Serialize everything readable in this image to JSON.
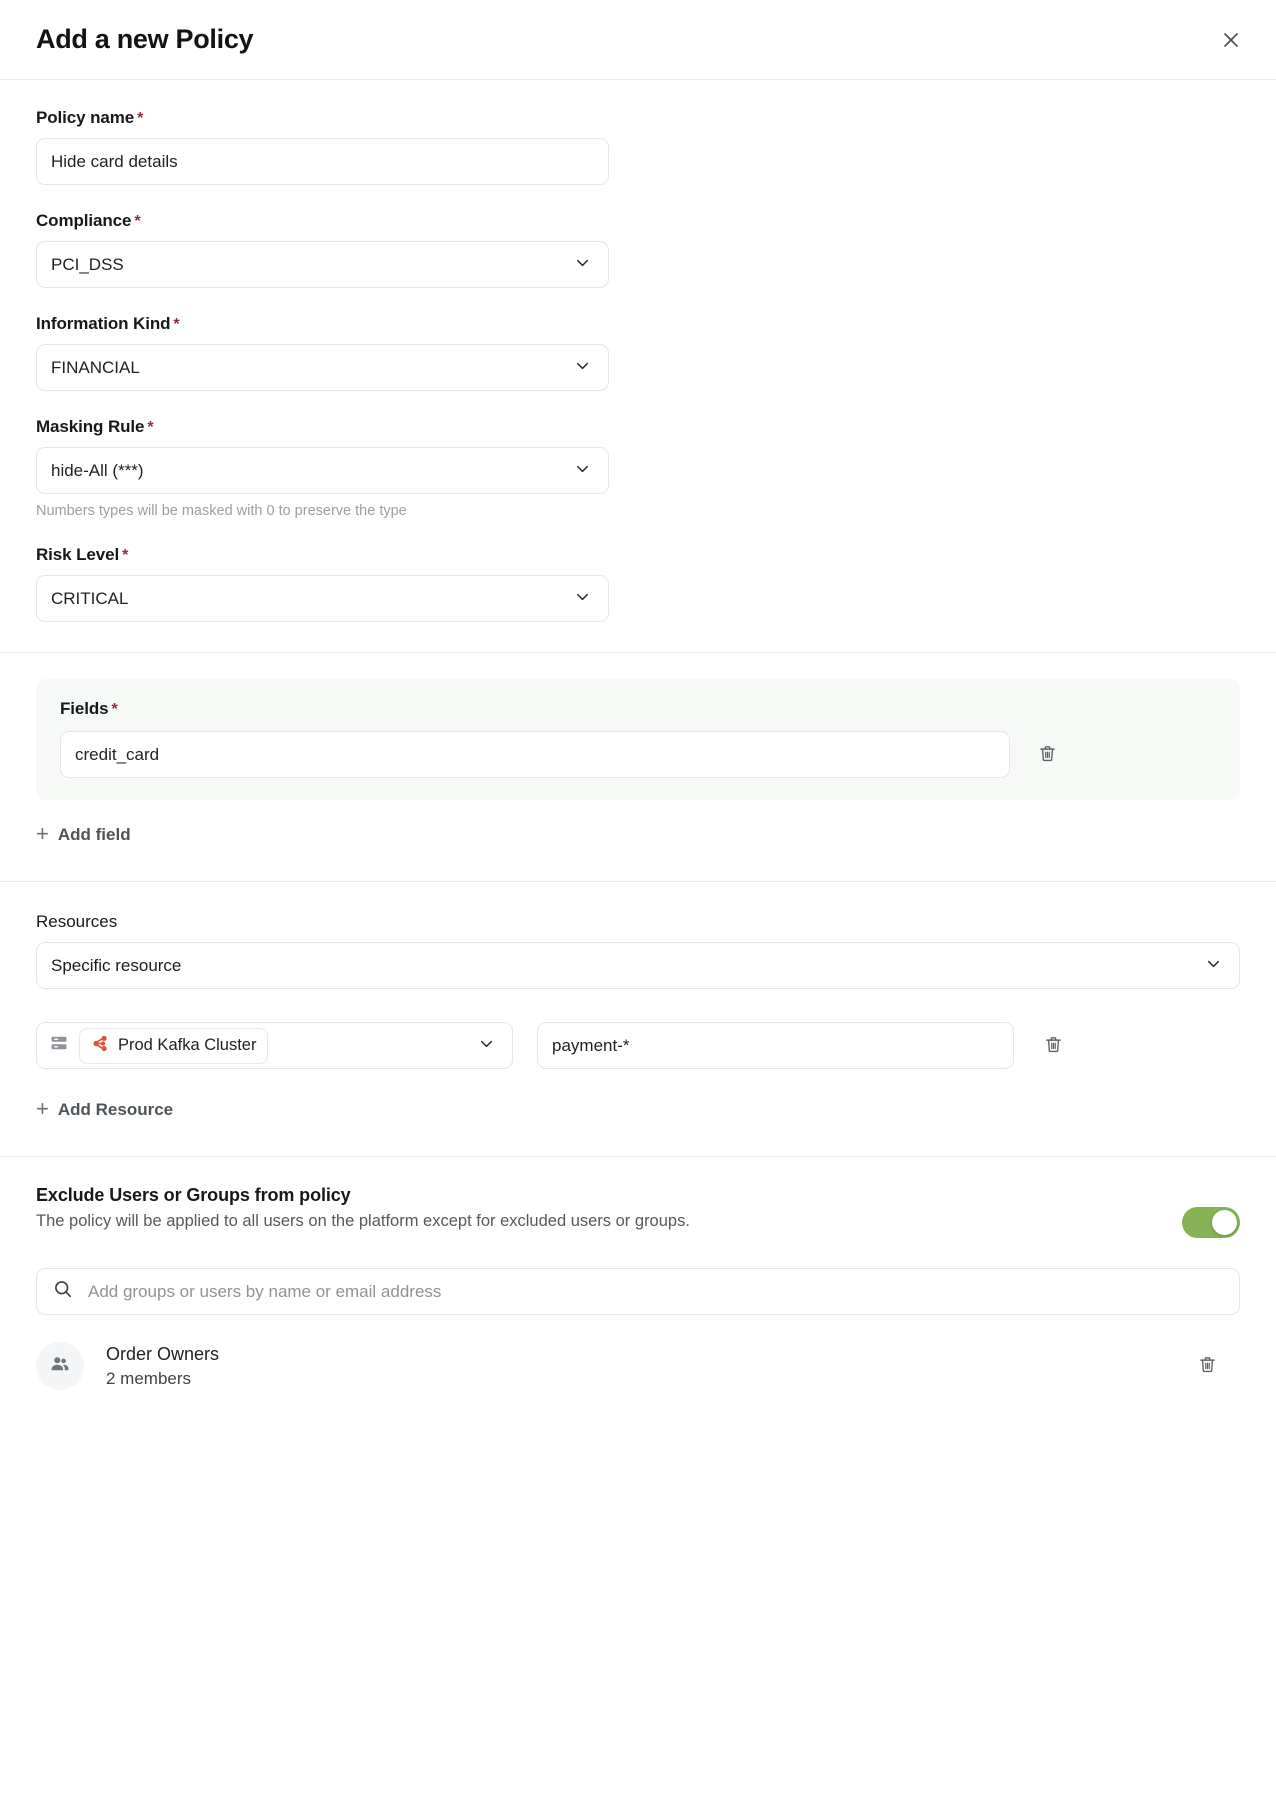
{
  "header": {
    "title": "Add a new Policy",
    "close_icon": "close-icon"
  },
  "form": {
    "policy_name": {
      "label": "Policy name",
      "required_mark": "*",
      "value": "Hide card details"
    },
    "compliance": {
      "label": "Compliance",
      "required_mark": "*",
      "value": "PCI_DSS"
    },
    "information_kind": {
      "label": "Information Kind",
      "required_mark": "*",
      "value": "FINANCIAL"
    },
    "masking_rule": {
      "label": "Masking Rule",
      "required_mark": "*",
      "value": "hide-All (***)",
      "helper": "Numbers types will be masked with 0 to preserve the type"
    },
    "risk_level": {
      "label": "Risk Level",
      "required_mark": "*",
      "value": "CRITICAL"
    }
  },
  "fields_section": {
    "label": "Fields",
    "required_mark": "*",
    "rows": [
      {
        "value": "credit_card",
        "delete_icon": "trash-icon"
      }
    ],
    "add_label": "Add field",
    "add_icon": "plus-icon"
  },
  "resources_section": {
    "label": "Resources",
    "scope_value": "Specific resource",
    "rows": [
      {
        "source_icon": "server-stack-icon",
        "chip_icon": "kafka-icon",
        "chip_label": "Prod Kafka Cluster",
        "pattern_value": "payment-*",
        "delete_icon": "trash-icon"
      }
    ],
    "add_label": "Add Resource",
    "add_icon": "plus-icon"
  },
  "exclude_section": {
    "title": "Exclude Users or Groups from policy",
    "subtitle": "The policy will be applied to all users on the platform except for excluded users or groups.",
    "toggle_on": true,
    "search_placeholder": "Add groups or users by name or email address",
    "search_value": "",
    "search_icon": "search-icon",
    "entries": [
      {
        "avatar_icon": "group-people-icon",
        "name": "Order Owners",
        "detail": "2 members",
        "delete_icon": "trash-icon"
      }
    ]
  },
  "colors": {
    "required_red": "#8f2d3f",
    "toggle_green": "#85b356",
    "kafka_orange": "#dc5439",
    "panel_bg": "#f7f9f7",
    "border": "#e4e6e8"
  }
}
